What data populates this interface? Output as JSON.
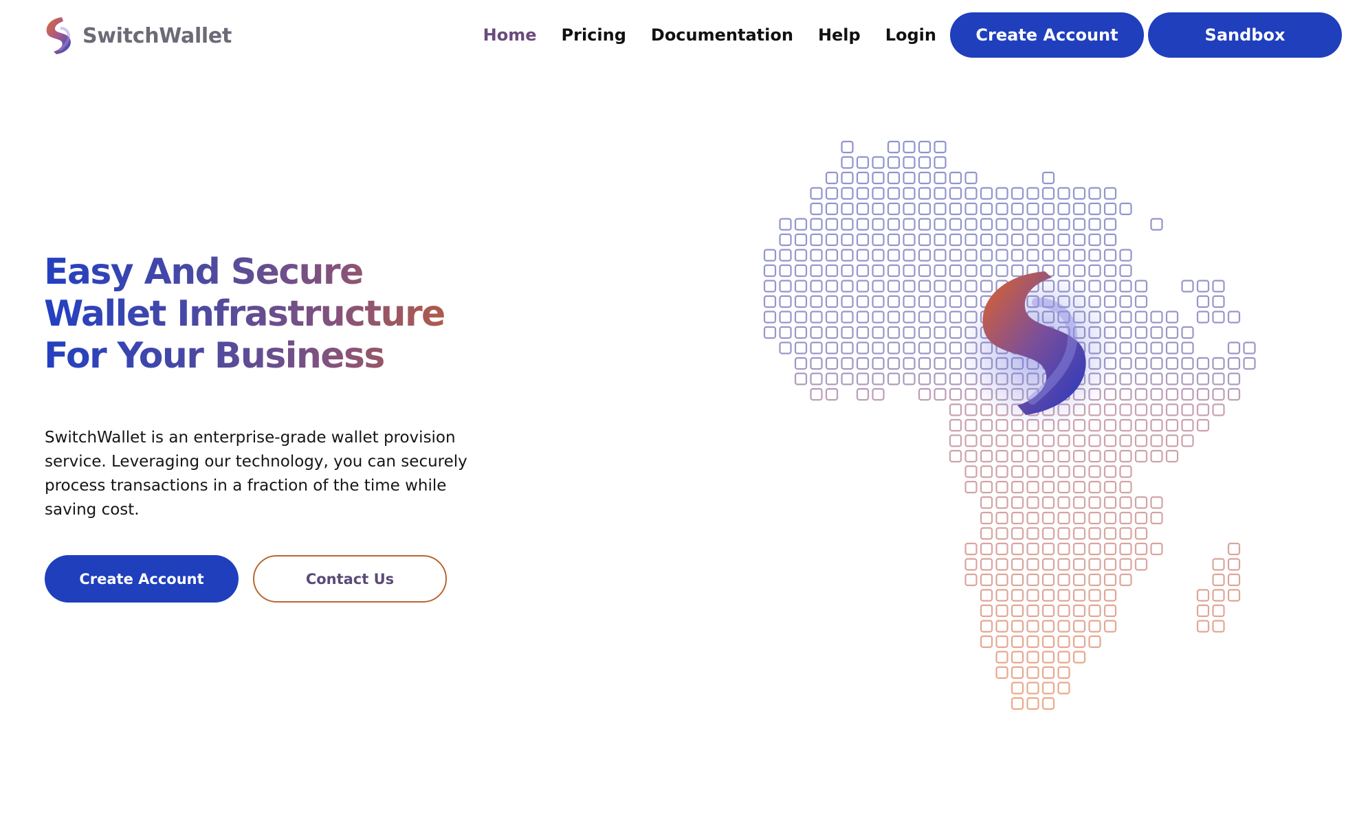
{
  "brand": {
    "name": "SwitchWallet",
    "logo_icon": "switchwallet-s-logo-icon"
  },
  "nav": {
    "links": [
      {
        "label": "Home",
        "active": true
      },
      {
        "label": "Pricing",
        "active": false
      },
      {
        "label": "Documentation",
        "active": false
      },
      {
        "label": "Help",
        "active": false
      },
      {
        "label": "Login",
        "active": false
      }
    ],
    "create_account_label": "Create Account",
    "sandbox_label": "Sandbox"
  },
  "hero": {
    "title_lines": [
      "Easy And Secure",
      "Wallet Infrastructure",
      "For Your Business"
    ],
    "description": "SwitchWallet is an enterprise-grade wallet provision service. Leveraging our technology, you can securely process transactions in a fraction of the time while saving cost.",
    "primary_cta": "Create Account",
    "secondary_cta": "Contact Us"
  },
  "illustration": {
    "icon": "africa-pixel-map-icon",
    "center_icon": "switchwallet-s-logo-icon"
  },
  "colors": {
    "primary_blue": "#1f3fbd",
    "accent_orange": "#c8602e",
    "nav_active": "#6a4a7c",
    "map_top": "#8d93cf",
    "map_bottom": "#f0a985"
  }
}
